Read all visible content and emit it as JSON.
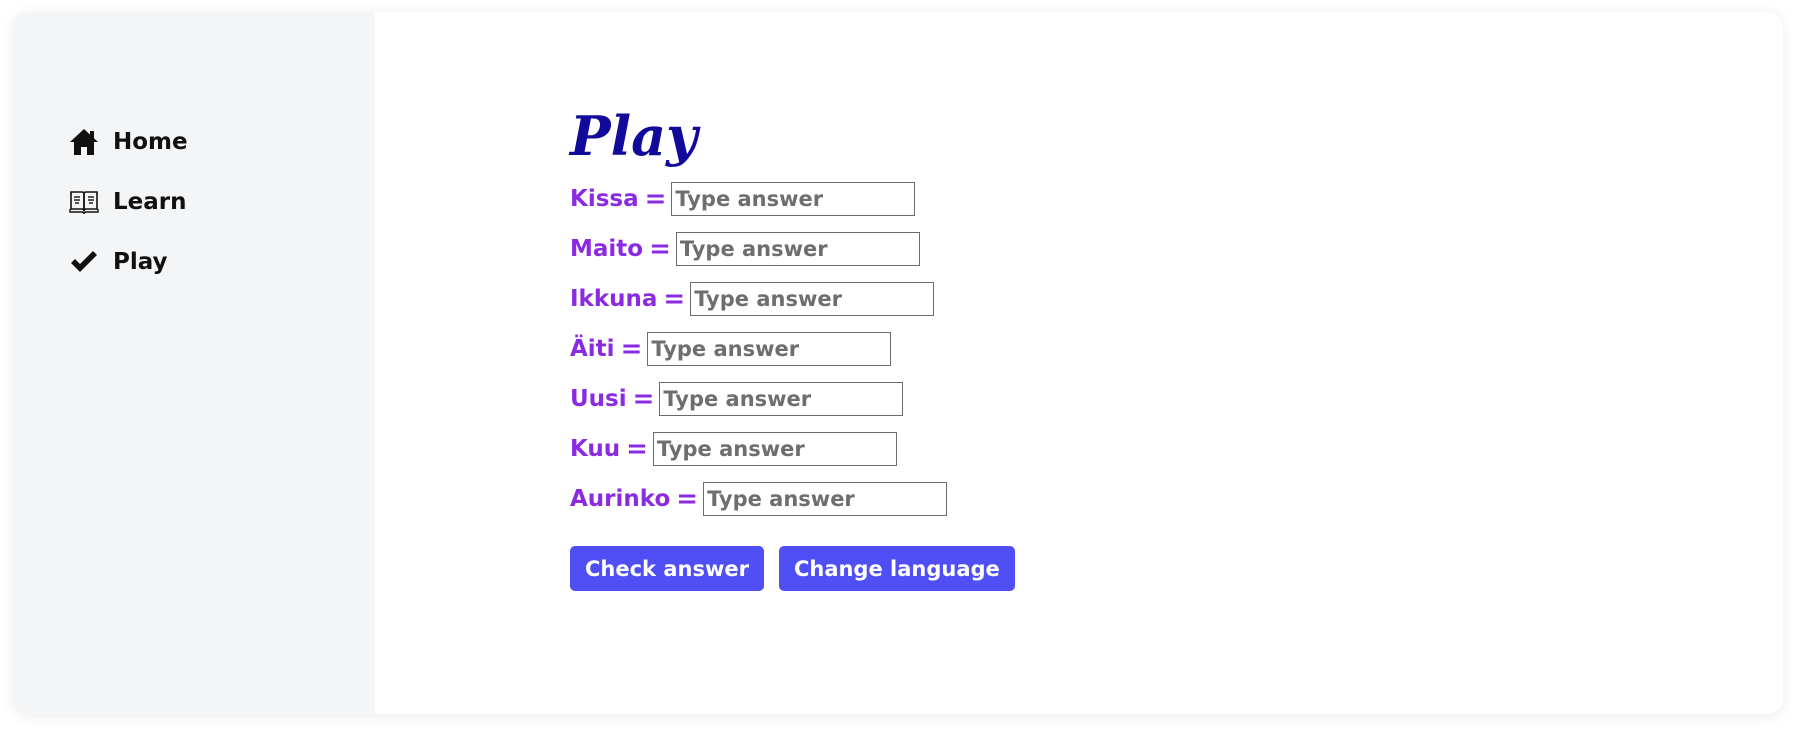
{
  "sidebar": {
    "items": [
      {
        "label": "Home",
        "icon": "home-icon"
      },
      {
        "label": "Learn",
        "icon": "open-book-icon"
      },
      {
        "label": "Play",
        "icon": "checkmark-icon"
      }
    ]
  },
  "main": {
    "title": "Play",
    "questions": [
      {
        "word": "Kissa",
        "placeholder": "Type answer",
        "value": ""
      },
      {
        "word": "Maito",
        "placeholder": "Type answer",
        "value": ""
      },
      {
        "word": "Ikkuna",
        "placeholder": "Type answer",
        "value": ""
      },
      {
        "word": "Äiti",
        "placeholder": "Type answer",
        "value": ""
      },
      {
        "word": "Uusi",
        "placeholder": "Type answer",
        "value": ""
      },
      {
        "word": "Kuu",
        "placeholder": "Type answer",
        "value": ""
      },
      {
        "word": "Aurinko",
        "placeholder": "Type answer",
        "value": ""
      }
    ],
    "equals_sign": "=",
    "check_label": "Check answer",
    "change_language_label": "Change language"
  },
  "colors": {
    "title": "#110a9a",
    "word": "#8a2be2",
    "button": "#4f4ff5",
    "sidebar_bg": "#f4f5f7"
  }
}
